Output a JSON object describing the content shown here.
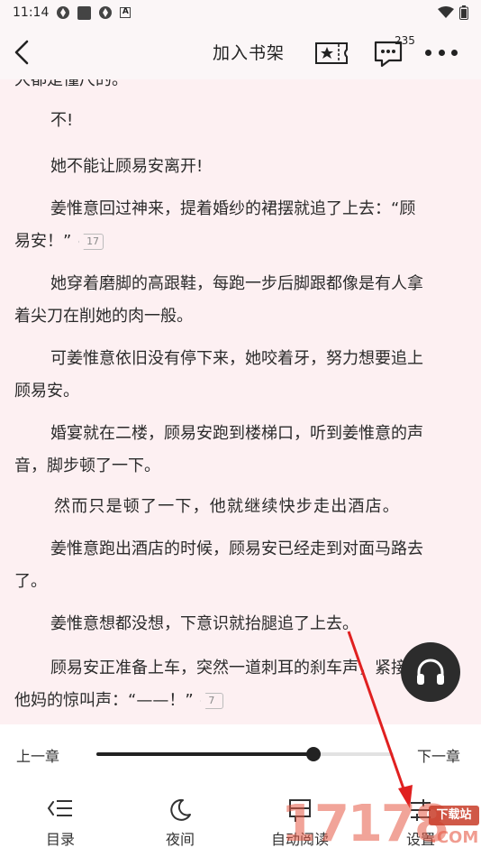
{
  "status_bar": {
    "time": "11:14"
  },
  "header": {
    "add_shelf": "加入书架",
    "comment_count": "235"
  },
  "content": {
    "cutoff_text": "大都是懂尺的。",
    "paragraphs": [
      {
        "text": "不!"
      },
      {
        "text": "她不能让顾易安离开!"
      },
      {
        "text": "姜惟意回过神来，提着婚纱的裙摆就追了上去：“顾",
        "cont": "易安！”",
        "badge": "17"
      },
      {
        "text": "她穿着磨脚的高跟鞋，每跑一步后脚跟都像是有人拿",
        "cont": "着尖刀在削她的肉一般。"
      },
      {
        "text": "可姜惟意依旧没有停下来，她咬着牙，努力想要追上",
        "cont": "顾易安。"
      },
      {
        "text": "婚宴就在二楼，顾易安跑到楼梯口，听到姜惟意的声",
        "cont": "音，脚步顿了一下。"
      },
      {
        "text": "然而只是顿了一下，他就继续快步走出酒店。"
      },
      {
        "text": "姜惟意跑出酒店的时候，顾易安已经走到对面马路去",
        "cont": "了。"
      },
      {
        "text": "姜惟意想都没想，下意识就抬腿追了上去。"
      },
      {
        "text": "顾易安正准备上车，突然一道刺耳的刹车声，紧接着是",
        "cont": "他妈的惊叫声：“——！”",
        "badge": "7"
      }
    ]
  },
  "bottom": {
    "prev_chapter": "上一章",
    "next_chapter": "下一章",
    "progress": 0.73,
    "tools": [
      {
        "label": "目录",
        "icon": "catalog-icon"
      },
      {
        "label": "夜间",
        "icon": "moon-icon"
      },
      {
        "label": "自动阅读",
        "icon": "auto-read-icon"
      },
      {
        "label": "设置",
        "icon": "settings-icon"
      }
    ]
  },
  "watermark": {
    "text": "17178",
    "tag": "下载站",
    "suffix": ".COM"
  },
  "colors": {
    "page_bg": "#fdf0f2",
    "panel_bg": "#ffffff",
    "text": "#2b2b2b",
    "accent": "#222222",
    "annotation_arrow": "#e02020"
  }
}
